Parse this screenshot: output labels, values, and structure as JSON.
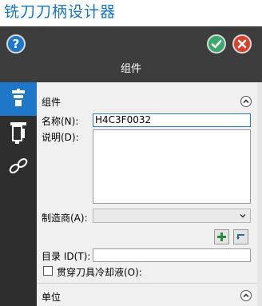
{
  "app": {
    "title": "铣刀刀柄设计器"
  },
  "header": {
    "title": "组件"
  },
  "sidebar": {
    "tabs": [
      {
        "icon": "tool-holder-icon",
        "active": true
      },
      {
        "icon": "tool-assembly-icon",
        "active": false
      },
      {
        "icon": "link-icon",
        "active": false
      }
    ]
  },
  "form": {
    "section_title": "组件",
    "name_label": "名称(N):",
    "name_value": "H4C3F0032",
    "description_label": "说明(D):",
    "description_value": "",
    "manufacturer_label": "制造商(A):",
    "manufacturer_value": "",
    "catalog_label": "目录 ID(T):",
    "catalog_value": "",
    "coolant_label": "贯穿刀具冷却液(O):",
    "coolant_checked": false
  },
  "units_section": {
    "title": "单位"
  },
  "colors": {
    "accent": "#1e77c8",
    "title_blue": "#1473c4",
    "ok": "#3aa86b",
    "cancel": "#d8402a",
    "header_bg": "#3d3d3d"
  }
}
